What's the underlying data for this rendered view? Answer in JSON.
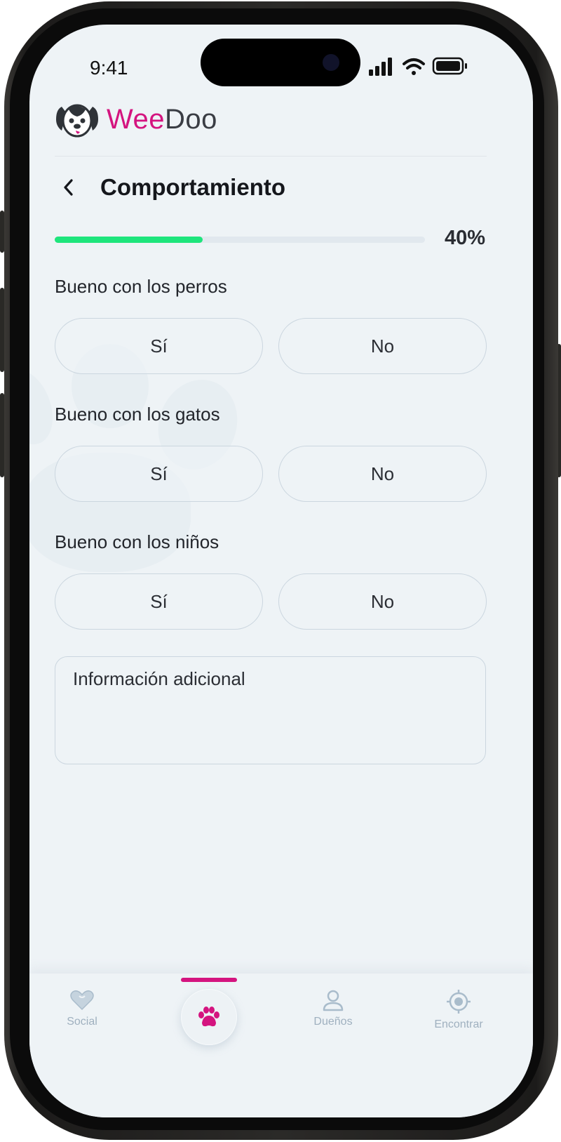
{
  "status_bar": {
    "time": "9:41"
  },
  "brand": {
    "name_part1": "Wee",
    "name_part2": "Doo",
    "logo_icon": "dog-face-icon"
  },
  "header": {
    "title": "Comportamiento",
    "back_icon": "chevron-left-icon"
  },
  "progress": {
    "value": 0.4,
    "label": "40%",
    "fill_color": "#1ee57c"
  },
  "questions": [
    {
      "label": "Bueno con los perros",
      "yes": "Sí",
      "no": "No"
    },
    {
      "label": "Bueno con los gatos",
      "yes": "Sí",
      "no": "No"
    },
    {
      "label": "Bueno con los niños",
      "yes": "Sí",
      "no": "No"
    }
  ],
  "additional_info": {
    "placeholder": "Información adicional",
    "value": ""
  },
  "bottom_nav": {
    "active_index": 1,
    "items": [
      {
        "label": "Social",
        "icon": "heart-icon"
      },
      {
        "label": "",
        "icon": "paw-icon"
      },
      {
        "label": "Dueños",
        "icon": "person-icon"
      },
      {
        "label": "Encontrar",
        "icon": "crosshair-icon"
      }
    ]
  },
  "colors": {
    "brand_pink": "#d4147f",
    "accent_green": "#1ee57c",
    "background": "#eef3f6"
  }
}
